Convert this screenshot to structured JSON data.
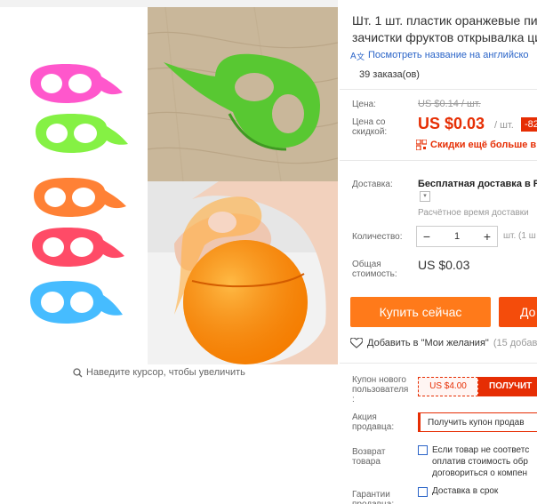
{
  "gallery": {
    "zoom_hint": "Наведите курсор, чтобы увеличить"
  },
  "product": {
    "title_line1": "Шт. 1 шт. пластик оранжевые пил",
    "title_line2": "зачистки фруктов открывалка цит",
    "translate_link": "Посмотреть название на английско",
    "orders": "39 заказа(ов)"
  },
  "pricing": {
    "price_label": "Цена:",
    "old_price": "US $0.14 / шт.",
    "discount_label": "Цена со скидкой:",
    "price": "US $0.03",
    "per_unit": "/ шт.",
    "discount_badge": "-82",
    "app_deal": "Скидки ещё больше в п"
  },
  "shipping": {
    "label": "Доставка:",
    "value": "Бесплатная доставка в Ru",
    "estimate": "Расчётное время доставки"
  },
  "quantity": {
    "label": "Количество:",
    "minus": "−",
    "value": "1",
    "plus": "+",
    "note": "шт. (1 ш"
  },
  "total": {
    "label": "Общая стоимость:",
    "value": "US $0.03"
  },
  "actions": {
    "buy_now": "Купить сейчас",
    "add_to_cart": "До",
    "wishlist": "Добавить в \"Мои желания\"",
    "wishlist_count": "(15 добав"
  },
  "coupons": {
    "new_user_label": "Купон нового пользователя :",
    "new_user_value": "US $4.00",
    "new_user_get": "ПОЛУЧИТ",
    "seller_label": "Акция продавца:",
    "seller_value": "Получить купон продав"
  },
  "returns": {
    "label": "Возврат товара",
    "line1": "Если товар не соответс",
    "line2": "оплатив стоимость обр",
    "line3": "договориться о компен"
  },
  "guarantee": {
    "label": "Гарантии продавца:",
    "line1": "Доставка в срок"
  },
  "colors": {
    "accent_red": "#e62e04",
    "buy_orange": "#ff7a1a",
    "link_blue": "#2a64c8"
  }
}
